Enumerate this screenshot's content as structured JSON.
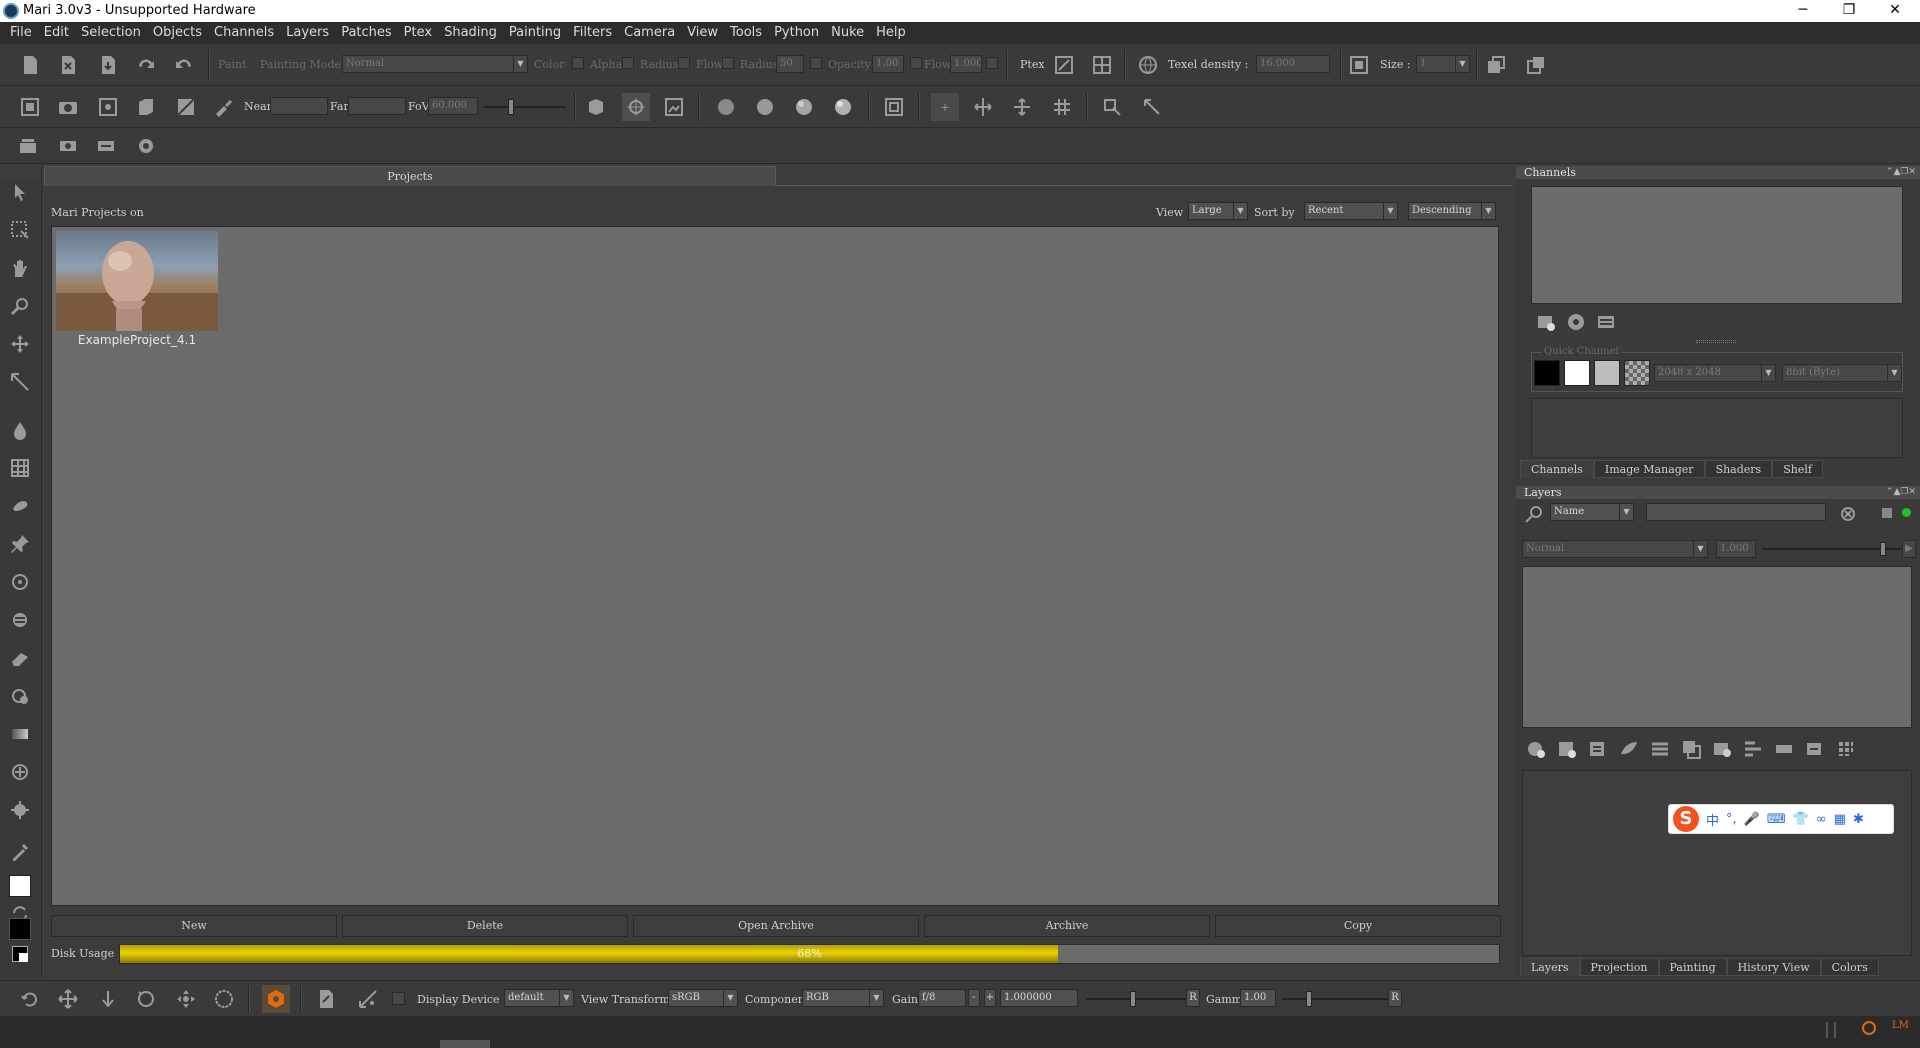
{
  "window": {
    "title": "Mari 3.0v3 - Unsupported Hardware",
    "minimize": "─",
    "maximize": "❐",
    "close": "✕"
  },
  "menu": [
    "File",
    "Edit",
    "Selection",
    "Objects",
    "Channels",
    "Layers",
    "Patches",
    "Ptex",
    "Shading",
    "Painting",
    "Filters",
    "Camera",
    "View",
    "Tools",
    "Python",
    "Nuke",
    "Help"
  ],
  "toolbar1": {
    "paint_label": "Paint",
    "painting_mode_label": "Painting Mode",
    "painting_mode_value": "Normal",
    "color_label": "Color",
    "alpha_label": "Alpha",
    "radius_label": "Radius",
    "flow_label": "Flow",
    "radius2_label": "Radius",
    "radius2_value": "50",
    "opacity_label": "Opacity",
    "opacity_value": "1.00",
    "flow2_label": "Flow",
    "flow2_value": "1.000",
    "ptex_label": "Ptex",
    "texel_label": "Texel density :",
    "texel_value": "16.000",
    "size_label": "Size :",
    "size_value": "1"
  },
  "toolbar2": {
    "near_label": "Near",
    "far_label": "Far",
    "fov_label": "FoV",
    "fov_value": "60.000",
    "plus_glyph": "+"
  },
  "projects": {
    "tab": "Projects",
    "header": "Mari Projects on",
    "view_label": "View",
    "view_value": "Large",
    "sort_label": "Sort by",
    "sort_value": "Recent",
    "order_value": "Descending",
    "items": [
      {
        "name": "ExampleProject_4.1"
      }
    ],
    "buttons": {
      "new": "New",
      "delete": "Delete",
      "open_archive": "Open Archive",
      "archive": "Archive",
      "copy": "Copy"
    },
    "disk_label": "Disk Usage",
    "disk_percent_text": "68%",
    "disk_fraction": 0.68
  },
  "channels_panel": {
    "title": "Channels",
    "quick_channel_label": "Quick Channel",
    "resolution_value": "2048 x 2048",
    "depth_value": "8bit (Byte)",
    "tabs": [
      "Channels",
      "Image Manager",
      "Shaders",
      "Shelf"
    ]
  },
  "layers_panel": {
    "title": "Layers",
    "filter_value": "Name",
    "blend_value": "Normal",
    "opacity_value": "1.000",
    "tabs": [
      "Layers",
      "Projection",
      "Painting",
      "History View",
      "Colors"
    ]
  },
  "bottom_toolbar": {
    "display_device_label": "Display Device",
    "display_device_value": "default",
    "view_transform_label": "View Transform",
    "view_transform_value": "sRGB",
    "component_label": "Component",
    "component_value": "RGB",
    "gain_label": "Gain",
    "gain_fstop": "f/8",
    "gain_minus": "-",
    "gain_plus": "+",
    "gain_value": "1.000000",
    "gain_reset": "R",
    "gamma_label": "Gamma",
    "gamma_value": "1.00",
    "gamma_reset": "R"
  },
  "ime_toolbar": {
    "logo": "S",
    "glyphs": [
      "中",
      "°,",
      "🎤",
      "⌨",
      "👕",
      "∞",
      "▦",
      "✱"
    ]
  },
  "colors": {
    "accent_orange": "#e06a10",
    "disk_bar": "#d8c400",
    "panel_bg": "#3a3a3a",
    "grid_bg": "#6b6b6b"
  }
}
